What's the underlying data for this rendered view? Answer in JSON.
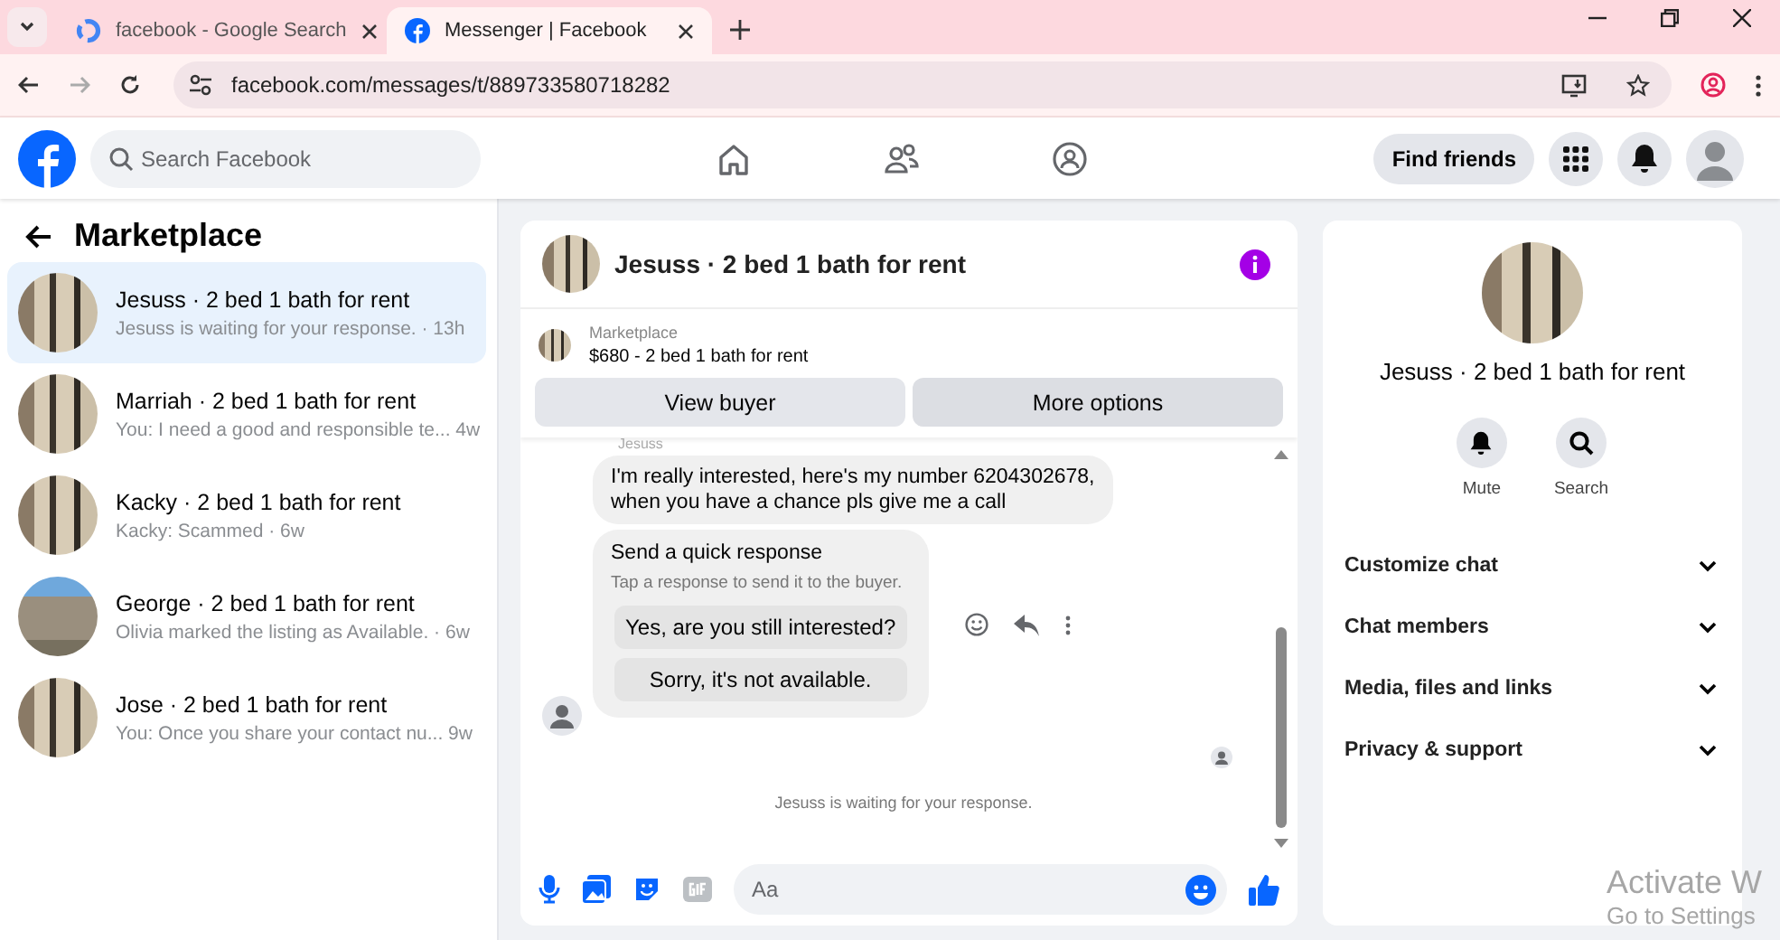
{
  "browser": {
    "tabs": [
      {
        "title": "facebook - Google Search",
        "selected": false
      },
      {
        "title": "Messenger | Facebook",
        "selected": true
      }
    ],
    "url": "facebook.com/messages/t/889733580718282"
  },
  "header": {
    "search": {
      "placeholder": "Search Facebook"
    },
    "find_friends": "Find friends"
  },
  "sidebar": {
    "title": "Marketplace",
    "items": [
      {
        "title": "Jesuss · 2 bed 1 bath for rent",
        "preview": "Jesuss is waiting for your response. · 13h",
        "selected": true
      },
      {
        "title": "Marriah · 2 bed 1 bath for rent",
        "preview": "You: I need a good and responsible te...  4w",
        "selected": false
      },
      {
        "title": "Kacky · 2 bed 1 bath for rent",
        "preview": "Kacky: Scammed · 6w",
        "selected": false
      },
      {
        "title": "George · 2 bed 1 bath for rent",
        "preview": "Olivia marked the listing as Available. · 6w",
        "selected": false
      },
      {
        "title": "Jose · 2 bed 1 bath for rent",
        "preview": "You: Once you share your contact nu...   9w",
        "selected": false
      }
    ]
  },
  "chat": {
    "title": "Jesuss · 2 bed 1 bath for rent",
    "listing": {
      "label": "Marketplace",
      "name": "$680 - 2 bed 1 bath for rent"
    },
    "buttons": [
      "View buyer",
      "More options"
    ],
    "sender": "Jesuss",
    "message_lines": [
      "I'm really interested, here's my number 6204302678,",
      "when you have a chance pls give me a call"
    ],
    "quick": {
      "title": "Send a quick response",
      "hint": "Tap a response to send it to the buyer.",
      "options": [
        "Yes, are you still interested?",
        "Sorry, it's not available."
      ]
    },
    "status": "Jesuss is waiting for your response.",
    "composer": {
      "placeholder": "Aa"
    }
  },
  "details": {
    "title": "Jesuss · 2 bed 1 bath for rent",
    "actions": [
      {
        "label": "Mute",
        "kind": "bell"
      },
      {
        "label": "Search",
        "kind": "search"
      }
    ],
    "sections": [
      "Customize chat",
      "Chat members",
      "Media, files and links",
      "Privacy & support"
    ]
  },
  "os_overlay": [
    "Activate W",
    "Go to Settings"
  ]
}
